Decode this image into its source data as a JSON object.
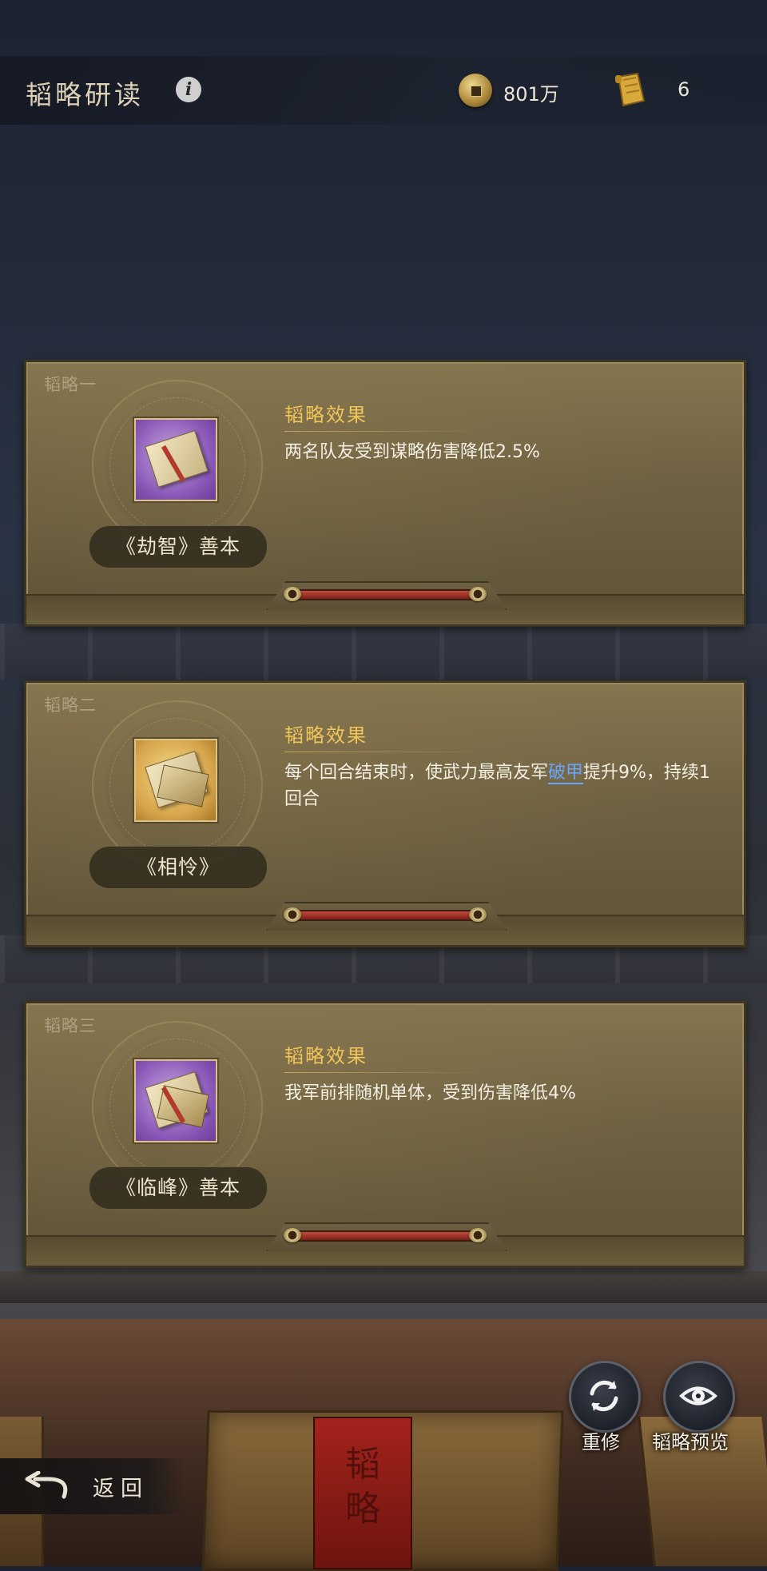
{
  "header": {
    "title": "韬略研读",
    "info_icon": "info-icon",
    "coins_value": "801万",
    "scrolls_value": "6"
  },
  "cards": [
    {
      "tag": "韬略一",
      "name": "《劫智》善本",
      "effect_title": "韬略效果",
      "effect_before": "两名队友受到谋略伤害降低2.5%",
      "keyword": "",
      "effect_after": "",
      "item_color": "purple"
    },
    {
      "tag": "韬略二",
      "name": "《相怜》",
      "effect_title": "韬略效果",
      "effect_before": "每个回合结束时，使武力最高友军",
      "keyword": "破甲",
      "effect_after": "提升9%，持续1回合",
      "item_color": "gold"
    },
    {
      "tag": "韬略三",
      "name": "《临峰》善本",
      "effect_title": "韬略效果",
      "effect_before": "我军前排随机单体，受到伤害降低4%",
      "keyword": "",
      "effect_after": "",
      "item_color": "purple"
    }
  ],
  "actions": {
    "rebuild_label": "重修",
    "preview_label": "韬略预览",
    "back_label": "返回"
  },
  "decor": {
    "box_label_text": "韬略"
  },
  "colors": {
    "effect_title": "#f0c55a",
    "keyword": "#6aa6ff",
    "card_bg": "#6f6242"
  }
}
